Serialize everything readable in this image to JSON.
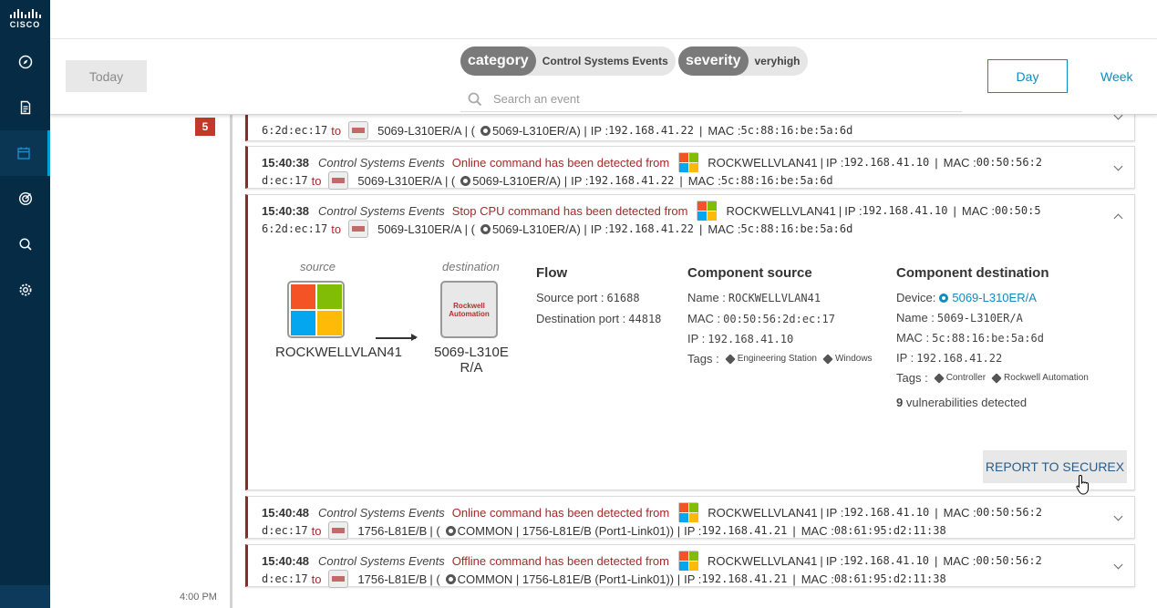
{
  "brand": {
    "logo_text": "CISCO"
  },
  "sidebar": {
    "items": [
      {
        "name": "compass-icon"
      },
      {
        "name": "document-icon"
      },
      {
        "name": "calendar-icon"
      },
      {
        "name": "target-icon"
      },
      {
        "name": "search-icon"
      },
      {
        "name": "settings-icon"
      }
    ]
  },
  "toolbar": {
    "today_label": "Today",
    "filters": [
      {
        "key": "category",
        "value": "Control Systems Events"
      },
      {
        "key": "severity",
        "value": "veryhigh"
      }
    ],
    "search_placeholder": "Search an event",
    "day_label": "Day",
    "week_label": "Week"
  },
  "timeline": {
    "count": "5",
    "time": "4:00 PM"
  },
  "events": [
    {
      "time": "",
      "category": "",
      "message": "",
      "src_name": "",
      "src_ip": "",
      "src_mac": "",
      "mac_tail": "6:2d:ec:17",
      "to": "to",
      "dst_name": "5069-L310ER/A",
      "dst_detail": "5069-L310ER/A",
      "dst_ip": "192.168.41.22",
      "dst_mac": "5c:88:16:be:5a:6d"
    },
    {
      "time": "15:40:38",
      "category": "Control Systems Events",
      "message": "Online command has been detected from",
      "src_name": "ROCKWELLVLAN41",
      "src_ip": "192.168.41.10",
      "src_mac": "00:50:56:2",
      "mac_tail": "d:ec:17",
      "to": "to",
      "dst_name": "5069-L310ER/A",
      "dst_detail": "5069-L310ER/A",
      "dst_ip": "192.168.41.22",
      "dst_mac": "5c:88:16:be:5a:6d"
    },
    {
      "time": "15:40:38",
      "category": "Control Systems Events",
      "message": "Stop CPU command has been detected from",
      "src_name": "ROCKWELLVLAN41",
      "src_ip": "192.168.41.10",
      "src_mac": "00:50:5",
      "mac_tail": "6:2d:ec:17",
      "to": "to",
      "dst_name": "5069-L310ER/A",
      "dst_detail": "5069-L310ER/A",
      "dst_ip": "192.168.41.22",
      "dst_mac": "5c:88:16:be:5a:6d"
    },
    {
      "time": "15:40:48",
      "category": "Control Systems Events",
      "message": "Online command has been detected from",
      "src_name": "ROCKWELLVLAN41",
      "src_ip": "192.168.41.10",
      "src_mac": "00:50:56:2",
      "mac_tail": "d:ec:17",
      "to": "to",
      "dst_name": "1756-L81E/B",
      "dst_detail": "COMMON | 1756-L81E/B (Port1-Link01)",
      "dst_ip": "192.168.41.21",
      "dst_mac": "08:61:95:d2:11:38"
    },
    {
      "time": "15:40:48",
      "category": "Control Systems Events",
      "message": "Offline command has been detected from",
      "src_name": "ROCKWELLVLAN41",
      "src_ip": "192.168.41.10",
      "src_mac": "00:50:56:2",
      "mac_tail": "d:ec:17",
      "to": "to",
      "dst_name": "1756-L81E/B",
      "dst_detail": "COMMON | 1756-L81E/B (Port1-Link01)",
      "dst_ip": "192.168.41.21",
      "dst_mac": "08:61:95:d2:11:38"
    }
  ],
  "labels": {
    "ip": "IP :",
    "mac": "MAC :"
  },
  "detail": {
    "source_label": "source",
    "destination_label": "destination",
    "source_name": "ROCKWELLVLAN41",
    "destination_name": "5069-L310E\nR/A",
    "ra_logo_text": "Rockwell\nAutomation",
    "flow": {
      "title": "Flow",
      "source_port_label": "Source port :",
      "source_port": "61688",
      "destination_port_label": "Destination port :",
      "destination_port": "44818"
    },
    "component_source": {
      "title": "Component source",
      "name_label": "Name :",
      "name": "ROCKWELLVLAN41",
      "mac_label": "MAC :",
      "mac": "00:50:56:2d:ec:17",
      "ip_label": "IP :",
      "ip": "192.168.41.10",
      "tags_label": "Tags :",
      "tags": [
        "Engineering Station",
        "Windows"
      ]
    },
    "component_destination": {
      "title": "Component destination",
      "device_label": "Device:",
      "device": "5069-L310ER/A",
      "name_label": "Name :",
      "name": "5069-L310ER/A",
      "mac_label": "MAC :",
      "mac": "5c:88:16:be:5a:6d",
      "ip_label": "IP :",
      "ip": "192.168.41.22",
      "tags_label": "Tags :",
      "tags": [
        "Controller",
        "Rockwell Automation"
      ],
      "vuln_count": "9",
      "vuln_text": "vulnerabilities detected"
    },
    "report_label": "REPORT TO SECUREX"
  },
  "colors": {
    "sidebar": "#062b45",
    "accent": "#0f8cbd",
    "alert": "#a52a2a",
    "card_border": "#8b2b2b"
  }
}
